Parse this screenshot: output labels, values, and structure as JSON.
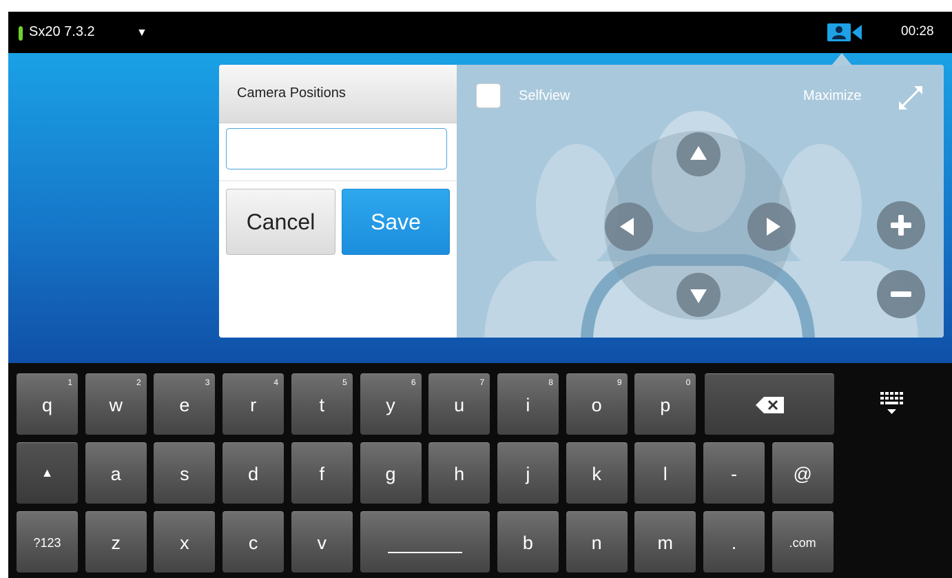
{
  "top_bar": {
    "device_name": "Sx20 7.3.2",
    "dropdown_glyph": "▼",
    "camera_icon": "camera-control-icon",
    "time": "00:28",
    "status_color": "#6fd22c"
  },
  "camera_positions": {
    "title": "Camera Positions",
    "name_input": {
      "value": "",
      "placeholder": ""
    },
    "cancel_label": "Cancel",
    "save_label": "Save"
  },
  "camera_view": {
    "selfview_label": "Selfview",
    "selfview_checked": false,
    "maximize_label": "Maximize",
    "controls": [
      "pan-up-icon",
      "pan-left-icon",
      "pan-right-icon",
      "pan-down-icon",
      "zoom-in-icon",
      "zoom-out-icon"
    ]
  },
  "keyboard": {
    "row1": [
      {
        "label": "q",
        "sub": "1"
      },
      {
        "label": "w",
        "sub": "2"
      },
      {
        "label": "e",
        "sub": "3"
      },
      {
        "label": "r",
        "sub": "4"
      },
      {
        "label": "t",
        "sub": "5"
      },
      {
        "label": "y",
        "sub": "6"
      },
      {
        "label": "u",
        "sub": "7"
      },
      {
        "label": "i",
        "sub": "8"
      },
      {
        "label": "o",
        "sub": "9"
      },
      {
        "label": "p",
        "sub": "0"
      }
    ],
    "row2": [
      {
        "label": "a"
      },
      {
        "label": "s"
      },
      {
        "label": "d"
      },
      {
        "label": "f"
      },
      {
        "label": "g"
      },
      {
        "label": "h"
      },
      {
        "label": "j"
      },
      {
        "label": "k"
      },
      {
        "label": "l"
      },
      {
        "label": "-"
      },
      {
        "label": "@"
      }
    ],
    "row3": [
      {
        "label": "?123"
      },
      {
        "label": "z"
      },
      {
        "label": "x"
      },
      {
        "label": "c"
      },
      {
        "label": "v"
      },
      {
        "label": "space"
      },
      {
        "label": "b"
      },
      {
        "label": "n"
      },
      {
        "label": "m"
      },
      {
        "label": "."
      },
      {
        "label": ".com"
      }
    ],
    "shift_glyph": "▲",
    "backspace_icon": "backspace-icon",
    "hide_keyboard_icon": "hide-keyboard-icon"
  }
}
